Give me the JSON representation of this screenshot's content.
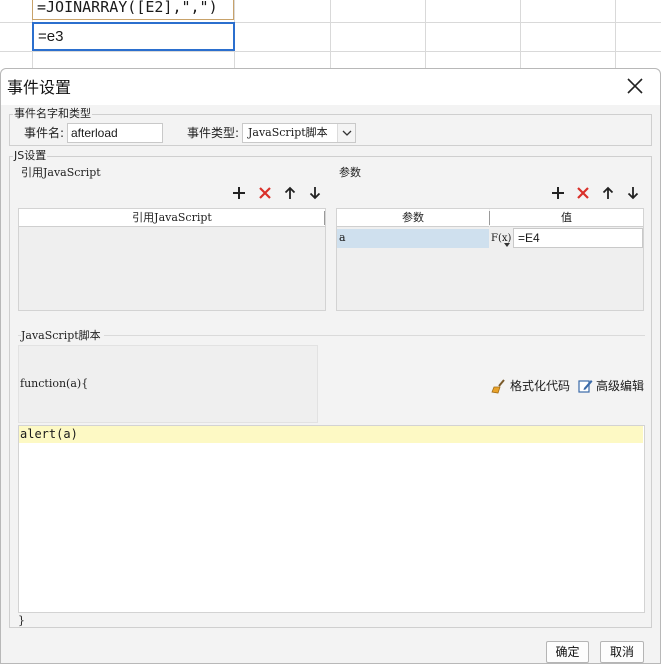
{
  "spreadsheet": {
    "cell_e2_formula": "=JOINARRAY([E2],\",\")",
    "cell_e3_value": "=e3"
  },
  "dialog": {
    "title": "事件设置",
    "name_group": {
      "legend": "事件名字和类型",
      "event_name_label": "事件名:",
      "event_name_value": "afterload",
      "event_type_label": "事件类型:",
      "event_type_value": "JavaScript脚本"
    },
    "js_group": {
      "legend": "JS设置",
      "ref_js": {
        "section_title": "引用JavaScript",
        "column_header": "引用JavaScript"
      },
      "params": {
        "section_title": "参数",
        "col_name": "参数",
        "col_value": "值",
        "rows": [
          {
            "name": "a",
            "fx": "F(x)",
            "value": "=E4"
          }
        ]
      },
      "script": {
        "section_title": "JavaScript脚本",
        "function_header": "function(a){",
        "code_lines": [
          "alert(a)"
        ],
        "closing": "}",
        "format_code_label": "格式化代码",
        "advanced_edit_label": "高级编辑"
      }
    },
    "buttons": {
      "ok": "确定",
      "cancel": "取消"
    }
  },
  "icons": {
    "add": "plus-icon",
    "delete": "x-icon",
    "up": "arrow-up-icon",
    "down": "arrow-down-icon",
    "close": "close-icon",
    "format": "broom-icon",
    "edit": "edit-pencil-icon"
  },
  "colors": {
    "delete_red": "#d9302a",
    "selection_blue": "#2b6fce",
    "param_row_bg": "#cfe0ee",
    "code_highlight": "#fdf9c4"
  }
}
